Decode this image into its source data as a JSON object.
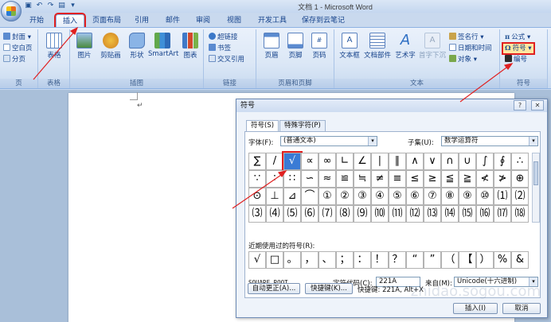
{
  "title_bar": {
    "title": "文档 1 - Microsoft Word"
  },
  "tabs": [
    "开始",
    "插入",
    "页面布局",
    "引用",
    "邮件",
    "审阅",
    "视图",
    "开发工具",
    "保存到云笔记"
  ],
  "ribbon": {
    "pages_group": {
      "label": "页",
      "items": [
        "封面",
        "空白页",
        "分页"
      ]
    },
    "table_group": {
      "label": "表格",
      "button": "表格"
    },
    "illustrations_group": {
      "label": "插图",
      "buttons": [
        "图片",
        "剪贴画",
        "形状",
        "SmartArt",
        "图表"
      ]
    },
    "links_group": {
      "label": "链接",
      "items": [
        "超链接",
        "书签",
        "交叉引用"
      ]
    },
    "header_footer_group": {
      "label": "页眉和页脚",
      "buttons": [
        "页眉",
        "页脚",
        "页码"
      ]
    },
    "text_group": {
      "label": "文本",
      "buttons": [
        "文本框",
        "文档部件",
        "艺术字",
        "首字下沉"
      ],
      "items": [
        "签名行",
        "日期和时间",
        "对象"
      ]
    },
    "symbols_group": {
      "label": "符号",
      "items": [
        "公式",
        "符号",
        "编号"
      ]
    }
  },
  "dialog": {
    "title": "符号",
    "help_btn": "?",
    "close_btn": "✕",
    "tabs": [
      "符号(S)",
      "特殊字符(P)"
    ],
    "font_label": "字体(F):",
    "font_value": "(普通文本)",
    "subset_label": "子集(U):",
    "subset_value": "数学运算符",
    "symbols": [
      [
        "∑",
        "/",
        "√",
        "∝",
        "∞",
        "∟",
        "∠",
        "∣",
        "∥",
        "∧",
        "∨",
        "∩",
        "∪",
        "∫",
        "∮",
        "∴"
      ],
      [
        "∵",
        "∶",
        "∷",
        "∽",
        "≈",
        "≌",
        "≒",
        "≠",
        "≡",
        "≤",
        "≥",
        "≦",
        "≧",
        "≮",
        "≯",
        "⊕"
      ],
      [
        "⊙",
        "⊥",
        "⊿",
        "⌒",
        "①",
        "②",
        "③",
        "④",
        "⑤",
        "⑥",
        "⑦",
        "⑧",
        "⑨",
        "⑩",
        "⑴",
        "⑵"
      ],
      [
        "⑶",
        "⑷",
        "⑸",
        "⑹",
        "⑺",
        "⑻",
        "⑼",
        "⑽",
        "⑾",
        "⑿",
        "⒀",
        "⒁",
        "⒂",
        "⒃",
        "⒄",
        "⒅"
      ]
    ],
    "recent_label": "近期使用过的符号(R):",
    "recent": [
      "√",
      "□",
      "。",
      "，",
      "、",
      "；",
      "：",
      "！",
      "？",
      "“",
      "”",
      "（",
      "【",
      "）",
      "%",
      "&"
    ],
    "char_name": "SQUARE ROOT",
    "char_code_label": "字符代码(C):",
    "char_code_value": "221A",
    "from_label": "来自(M):",
    "from_value": "Unicode(十六进制)",
    "autocorrect_btn": "自动更正(A)...",
    "shortcut_btn": "快捷键(K)...",
    "shortcut_text": "快捷键: 221A, Alt+X",
    "insert_btn": "插入(I)",
    "cancel_btn": "取消"
  },
  "watermark": "zhidao.sogou.com"
}
